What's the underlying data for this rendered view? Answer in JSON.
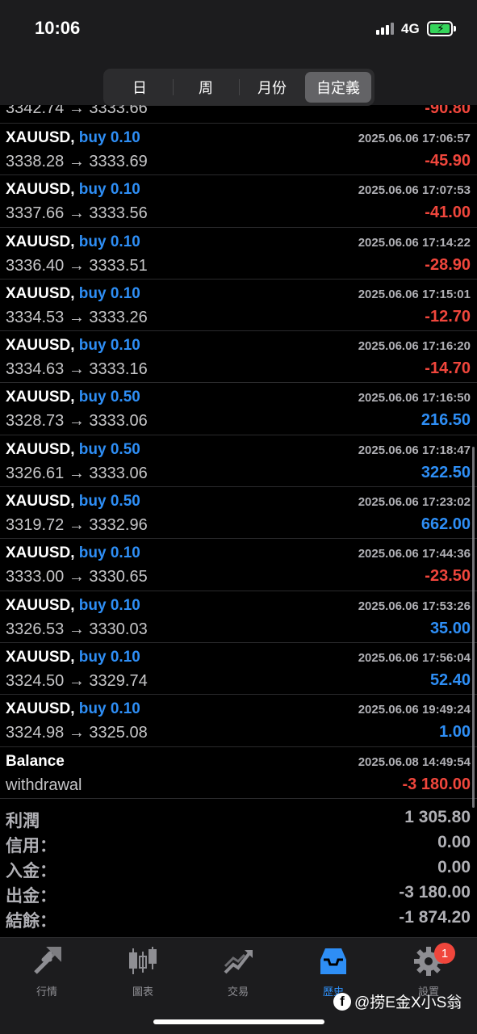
{
  "status_bar": {
    "time": "10:06",
    "network": "4G"
  },
  "segments": {
    "items": [
      "日",
      "周",
      "月份",
      "自定義"
    ],
    "active_index": 3
  },
  "partial_row": {
    "prices": "3342.74 → 3333.66",
    "profit": "-90.80"
  },
  "trades": [
    {
      "symbol": "XAUUSD,",
      "side": "buy 0.10",
      "date": "2025.06.06 17:06:57",
      "prices": "3338.28 → 3333.69",
      "profit": "-45.90",
      "type": "neg"
    },
    {
      "symbol": "XAUUSD,",
      "side": "buy 0.10",
      "date": "2025.06.06 17:07:53",
      "prices": "3337.66 → 3333.56",
      "profit": "-41.00",
      "type": "neg"
    },
    {
      "symbol": "XAUUSD,",
      "side": "buy 0.10",
      "date": "2025.06.06 17:14:22",
      "prices": "3336.40 → 3333.51",
      "profit": "-28.90",
      "type": "neg"
    },
    {
      "symbol": "XAUUSD,",
      "side": "buy 0.10",
      "date": "2025.06.06 17:15:01",
      "prices": "3334.53 → 3333.26",
      "profit": "-12.70",
      "type": "neg"
    },
    {
      "symbol": "XAUUSD,",
      "side": "buy 0.10",
      "date": "2025.06.06 17:16:20",
      "prices": "3334.63 → 3333.16",
      "profit": "-14.70",
      "type": "neg"
    },
    {
      "symbol": "XAUUSD,",
      "side": "buy 0.50",
      "date": "2025.06.06 17:16:50",
      "prices": "3328.73 → 3333.06",
      "profit": "216.50",
      "type": "pos"
    },
    {
      "symbol": "XAUUSD,",
      "side": "buy 0.50",
      "date": "2025.06.06 17:18:47",
      "prices": "3326.61 → 3333.06",
      "profit": "322.50",
      "type": "pos"
    },
    {
      "symbol": "XAUUSD,",
      "side": "buy 0.50",
      "date": "2025.06.06 17:23:02",
      "prices": "3319.72 → 3332.96",
      "profit": "662.00",
      "type": "pos"
    },
    {
      "symbol": "XAUUSD,",
      "side": "buy 0.10",
      "date": "2025.06.06 17:44:36",
      "prices": "3333.00 → 3330.65",
      "profit": "-23.50",
      "type": "neg"
    },
    {
      "symbol": "XAUUSD,",
      "side": "buy 0.10",
      "date": "2025.06.06 17:53:26",
      "prices": "3326.53 → 3330.03",
      "profit": "35.00",
      "type": "pos"
    },
    {
      "symbol": "XAUUSD,",
      "side": "buy 0.10",
      "date": "2025.06.06 17:56:04",
      "prices": "3324.50 → 3329.74",
      "profit": "52.40",
      "type": "pos"
    },
    {
      "symbol": "XAUUSD,",
      "side": "buy 0.10",
      "date": "2025.06.06 19:49:24",
      "prices": "3324.98 → 3325.08",
      "profit": "1.00",
      "type": "pos"
    },
    {
      "symbol": "Balance",
      "side": "",
      "date": "2025.06.08 14:49:54",
      "prices": "withdrawal",
      "profit": "-3 180.00",
      "type": "neg"
    }
  ],
  "summary": [
    {
      "label": "利潤",
      "value": "1 305.80"
    },
    {
      "label": "信用：",
      "value": "0.00"
    },
    {
      "label": "入金：",
      "value": "0.00"
    },
    {
      "label": "出金：",
      "value": "-3 180.00"
    },
    {
      "label": "結餘：",
      "value": "-1 874.20"
    }
  ],
  "tabs": [
    {
      "label": "行情",
      "icon": "quotes-arrows-icon"
    },
    {
      "label": "圖表",
      "icon": "candlestick-icon"
    },
    {
      "label": "交易",
      "icon": "trade-chart-icon"
    },
    {
      "label": "歷史",
      "icon": "history-inbox-icon",
      "active": true
    },
    {
      "label": "設置",
      "icon": "gear-icon",
      "badge": "1"
    }
  ],
  "watermark": {
    "text": "@捞E金X小S翁"
  },
  "colors": {
    "negative": "#f0463c",
    "positive": "#2e8ef5",
    "background": "#000000"
  }
}
